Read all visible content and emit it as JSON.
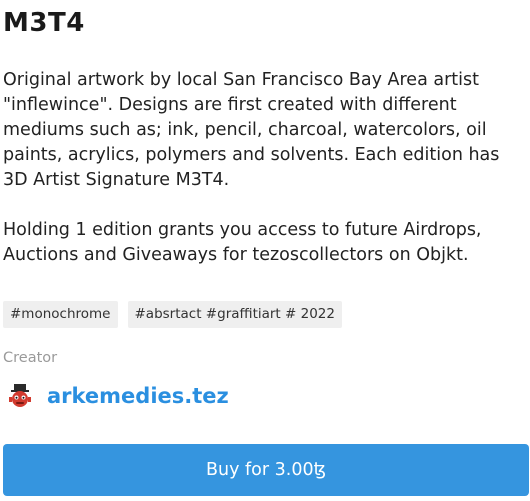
{
  "token": {
    "title": "M3T4",
    "description_paragraphs": [
      "Original artwork by local San Francisco Bay Area artist \"inflewince\". Designs are first created with different mediums such as; ink, pencil, charcoal, watercolors, oil paints, acrylics, polymers and solvents. Each edition has 3D Artist Signature M3T4.",
      "Holding 1 edition grants you access to future Airdrops, Auctions and Giveaways for tezoscollectors on Objkt."
    ]
  },
  "tags": [
    "#monochrome",
    "#absrtact #graffitiart # 2022"
  ],
  "creator": {
    "label": "Creator",
    "name": "arkemedies.tez",
    "avatar_icon": "red-creature-avatar-icon"
  },
  "buy_button": {
    "label": "Buy for 3.00ꜩ"
  },
  "colors": {
    "accent_blue": "#3595df",
    "link_blue": "#2a8fe0",
    "tag_background": "#efefef",
    "muted_text": "#9a9a9a"
  }
}
